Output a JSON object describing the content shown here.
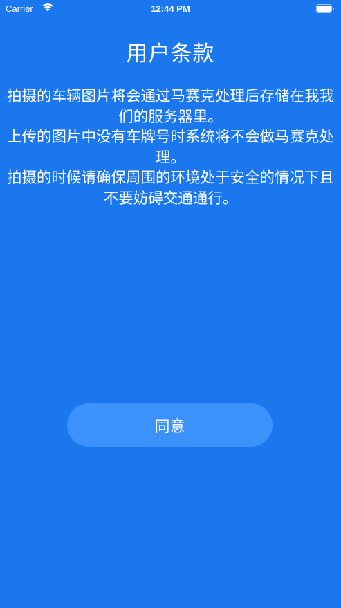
{
  "status_bar": {
    "carrier": "Carrier",
    "time": "12:44 PM",
    "wifi_icon": "wifi-icon",
    "battery_icon": "battery-icon"
  },
  "page": {
    "title": "用户条款",
    "body": "拍摄的车辆图片将会通过马赛克处理后存储在我我们的服务器里。\n上传的图片中没有车牌号时系统将不会做马赛克处理。\n拍摄的时候请确保周围的环境处于安全的情况下且不要妨碍交通通行。",
    "agree_label": "同意"
  },
  "colors": {
    "background": "#1a77ee",
    "button": "#3b92fb",
    "text": "#ffffff"
  }
}
